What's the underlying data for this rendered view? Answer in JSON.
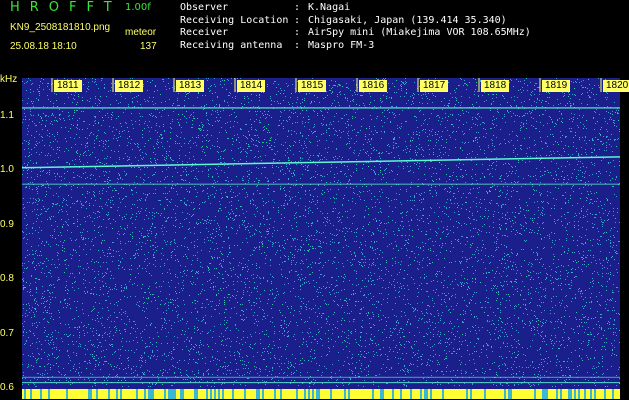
{
  "header": {
    "app_title": "HROFFT",
    "version": "1.00f",
    "file_name": "KN9_2508181810.png",
    "mode": "meteor",
    "timestamp": "25.08.18 18:10",
    "count": "137"
  },
  "info": [
    {
      "label": "Observer",
      "sep": ":",
      "value": "K.Nagai"
    },
    {
      "label": "Receiving Location",
      "sep": ":",
      "value": "Chigasaki, Japan (139.414 35.340)"
    },
    {
      "label": "Receiver",
      "sep": ":",
      "value": "AirSpy mini (Miakejima VOR 108.65MHz)"
    },
    {
      "label": "Receiving antenna",
      "sep": ":",
      "value": "Maspro FM-3"
    }
  ],
  "plot": {
    "y_unit": "kHz",
    "y_ticks": [
      "1.1",
      "1.0",
      "0.9",
      "0.8",
      "0.7",
      "0.6"
    ],
    "y_range": [
      0.58,
      1.17
    ],
    "x_ticks": [
      "1811",
      "1812",
      "1813",
      "1814",
      "1815",
      "1816",
      "1817",
      "1818",
      "1819",
      "1820"
    ],
    "colors": {
      "background": "#1a1f8c",
      "noise_cyan": "#39b8d6",
      "noise_green": "#2ee6a0",
      "carrier": "#5df7d0",
      "bottom_bar": "#ffff33",
      "label": "#ffff66"
    }
  }
}
